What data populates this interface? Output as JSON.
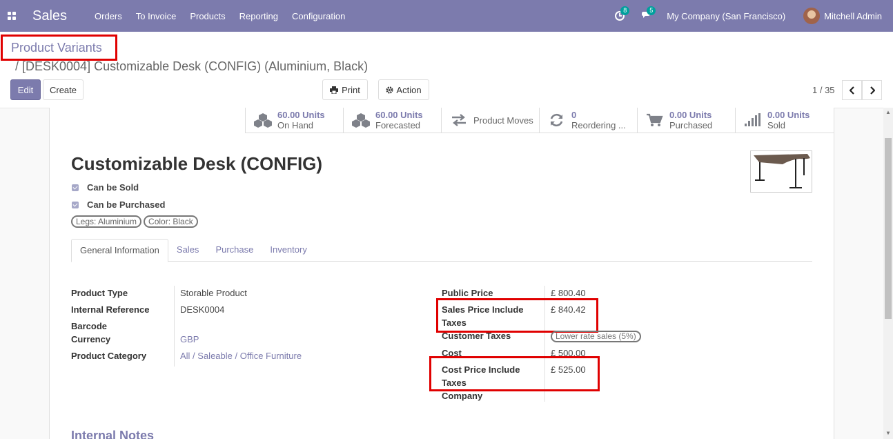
{
  "navbar": {
    "app_name": "Sales",
    "menu": [
      "Orders",
      "To Invoice",
      "Products",
      "Reporting",
      "Configuration"
    ],
    "activity_count": "8",
    "message_count": "5",
    "company": "My Company (San Francisco)",
    "user": "Mitchell Admin"
  },
  "breadcrumb": {
    "parent": "Product Variants",
    "current": "/ [DESK0004] Customizable Desk (CONFIG) (Aluminium, Black)"
  },
  "toolbar": {
    "edit": "Edit",
    "create": "Create",
    "print": "Print",
    "action": "Action",
    "pager": "1 / 35"
  },
  "smart_buttons": [
    {
      "value": "60.00 Units",
      "label": "On Hand",
      "icon": "cubes-icon"
    },
    {
      "value": "60.00 Units",
      "label": "Forecasted",
      "icon": "cubes-icon"
    },
    {
      "value": "",
      "label": "Product Moves",
      "icon": "exchange-icon"
    },
    {
      "value": "0",
      "label": "Reordering ...",
      "icon": "refresh-icon"
    },
    {
      "value": "0.00 Units",
      "label": "Purchased",
      "icon": "cart-icon"
    },
    {
      "value": "0.00 Units",
      "label": "Sold",
      "icon": "signal-icon"
    }
  ],
  "product": {
    "name": "Customizable Desk (CONFIG)",
    "can_be_sold": "Can be Sold",
    "can_be_purchased": "Can be Purchased",
    "tags": [
      "Legs: Aluminium",
      "Color: Black"
    ]
  },
  "tabs": [
    "General Information",
    "Sales",
    "Purchase",
    "Inventory"
  ],
  "left_fields": {
    "product_type_label": "Product Type",
    "product_type": "Storable Product",
    "internal_ref_label": "Internal Reference",
    "internal_ref": "DESK0004",
    "barcode_label": "Barcode",
    "currency_label": "Currency",
    "currency": "GBP",
    "category_label": "Product Category",
    "category": "All / Saleable / Office Furniture"
  },
  "right_fields": {
    "public_price_label": "Public Price",
    "public_price": "£ 800.40",
    "sales_incl_label_1": "Sales Price Include",
    "sales_incl_label_2": "Taxes",
    "sales_incl": "£ 840.42",
    "customer_taxes_label": "Customer Taxes",
    "customer_taxes": "Lower rate sales (5%)",
    "cost_label": "Cost",
    "cost": "£ 500.00",
    "cost_incl_label_1": "Cost Price Include",
    "cost_incl_label_2": "Taxes",
    "cost_incl": "£ 525.00",
    "company_label": "Company"
  },
  "notes_title": "Internal Notes",
  "colors": {
    "brand": "#7c7bad",
    "highlight": "#e00000",
    "badge": "#00a09d"
  }
}
